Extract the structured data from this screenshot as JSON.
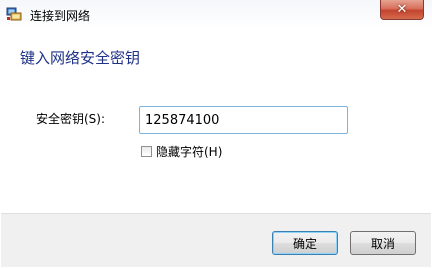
{
  "window": {
    "title": "连接到网络",
    "close_glyph": "✕"
  },
  "header": {
    "title": "键入网络安全密钥"
  },
  "form": {
    "key_label": "安全密钥(S):",
    "key_value": "125874100",
    "hide_chars_label": "隐藏字符(H)",
    "hide_chars_checked": false
  },
  "buttons": {
    "ok_label": "确定",
    "cancel_label": "取消"
  },
  "colors": {
    "header_text": "#1e3287",
    "close_button": "#c3442f",
    "footer_bg": "#f0f0f0",
    "input_border": "#7fb3d8"
  }
}
